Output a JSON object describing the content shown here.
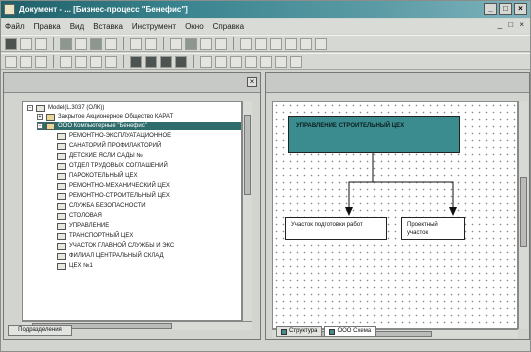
{
  "window": {
    "title": "Документ - ... [Бизнес-процесс \"Бенефис\"]",
    "controls": [
      "_",
      "□",
      "×"
    ]
  },
  "menubar": {
    "items": [
      "Файл",
      "Правка",
      "Вид",
      "Вставка",
      "Инструмент",
      "Окно",
      "Справка"
    ],
    "mdi_controls": "_ □ ×"
  },
  "tree": {
    "rows": [
      {
        "label": "Model(L.3037 (ОЛК))",
        "level": 0,
        "folder": false,
        "expander": "−"
      },
      {
        "label": "Закрытое Акционерное Общество КАРАТ",
        "level": 1,
        "folder": true,
        "expander": "+"
      },
      {
        "label": "ООО Компьютерные \"Бенефис\"",
        "level": 1,
        "folder": true,
        "expander": "−",
        "selected": true
      },
      {
        "label": "РЕМОНТНО-ЭКСПЛУАТАЦИОННОЕ",
        "level": 2,
        "folder": false
      },
      {
        "label": "САНАТОРИЙ ПРОФИЛАКТОРИЙ",
        "level": 2,
        "folder": false
      },
      {
        "label": "ДЕТСКИЕ ЯСЛИ САДЫ №",
        "level": 2,
        "folder": false
      },
      {
        "label": "ОТДЕЛ ТРУДОВЫХ СОГЛАШЕНИЙ",
        "level": 2,
        "folder": false
      },
      {
        "label": "ПАРОКОТЕЛЬНЫЙ ЦЕХ",
        "level": 2,
        "folder": false
      },
      {
        "label": "РЕМОНТНО-МЕХАНИЧЕСКИЙ ЦЕХ",
        "level": 2,
        "folder": false
      },
      {
        "label": "РЕМОНТНО-СТРОИТЕЛЬНЫЙ ЦЕХ",
        "level": 2,
        "folder": false
      },
      {
        "label": "СЛУЖБА БЕЗОПАСНОСТИ",
        "level": 2,
        "folder": false
      },
      {
        "label": "СТОЛОВАЯ",
        "level": 2,
        "folder": false
      },
      {
        "label": "УПРАВЛЕНИЕ",
        "level": 2,
        "folder": false
      },
      {
        "label": "ТРАНСПОРТНЫЙ ЦЕХ",
        "level": 2,
        "folder": false
      },
      {
        "label": "УЧАСТОК ГЛАВНОЙ СЛУЖБЫ И ЭКС",
        "level": 2,
        "folder": false
      },
      {
        "label": "ФИЛИАЛ ЦЕНТРАЛЬНЫЙ СКЛАД",
        "level": 2,
        "folder": false
      },
      {
        "label": "ЦЕХ №1",
        "level": 2,
        "folder": false
      }
    ]
  },
  "left_tab": "Подразделения",
  "diagram": {
    "top_node": "УПРАВЛЕНИЕ СТРОИТЕЛЬНЫЙ ЦЕХ",
    "child_nodes": [
      "Участок подготовки работ",
      "Проектный участок"
    ],
    "top_color": "#3b8c8f"
  },
  "bottom_tabs": [
    "Структура",
    "ООО Схема"
  ]
}
